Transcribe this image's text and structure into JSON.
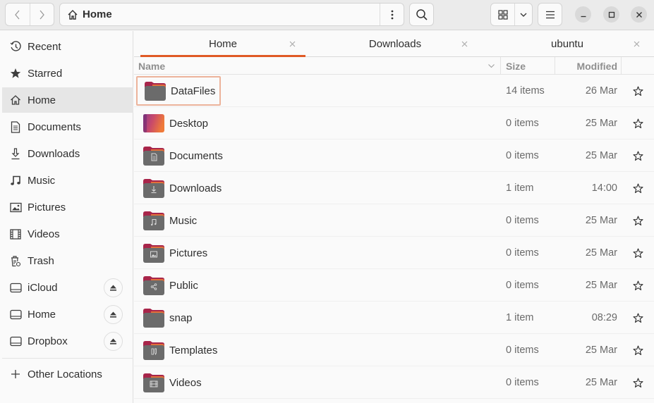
{
  "header": {
    "back_icon": "chevron-left-icon",
    "forward_icon": "chevron-right-icon",
    "path_icon": "home-icon",
    "path_label": "Home",
    "path_menu_icon": "vertical-dots-icon",
    "search_icon": "search-icon",
    "view_icon": "grid-view-icon",
    "view_dropdown_icon": "chevron-down-icon",
    "menu_icon": "hamburger-icon",
    "minimize_icon": "minimize-icon",
    "maximize_icon": "maximize-icon",
    "close_icon": "close-icon"
  },
  "sidebar": {
    "items": [
      {
        "label": "Recent",
        "icon": "clock-icon"
      },
      {
        "label": "Starred",
        "icon": "star-icon"
      },
      {
        "label": "Home",
        "icon": "home-icon",
        "active": true
      },
      {
        "label": "Documents",
        "icon": "document-icon"
      },
      {
        "label": "Downloads",
        "icon": "download-icon"
      },
      {
        "label": "Music",
        "icon": "music-icon"
      },
      {
        "label": "Pictures",
        "icon": "picture-icon"
      },
      {
        "label": "Videos",
        "icon": "video-icon"
      },
      {
        "label": "Trash",
        "icon": "trash-icon"
      },
      {
        "label": "iCloud",
        "icon": "drive-icon",
        "eject": true
      },
      {
        "label": "Home",
        "icon": "drive-icon",
        "eject": true
      },
      {
        "label": "Dropbox",
        "icon": "drive-icon",
        "eject": true
      }
    ],
    "other_locations": {
      "label": "Other Locations",
      "icon": "plus-icon"
    }
  },
  "tabs": [
    {
      "label": "Home",
      "active": true
    },
    {
      "label": "Downloads",
      "active": false
    },
    {
      "label": "ubuntu",
      "active": false
    }
  ],
  "columns": {
    "name": "Name",
    "size": "Size",
    "modified": "Modified"
  },
  "accent_color": "#e05a25",
  "files": [
    {
      "name": "DataFiles",
      "size": "14 items",
      "modified": "26 Mar",
      "emblem": "none",
      "selected": true
    },
    {
      "name": "Desktop",
      "size": "0 items",
      "modified": "25 Mar",
      "emblem": "desktop"
    },
    {
      "name": "Documents",
      "size": "0 items",
      "modified": "25 Mar",
      "emblem": "document"
    },
    {
      "name": "Downloads",
      "size": "1 item",
      "modified": "14:00",
      "emblem": "download"
    },
    {
      "name": "Music",
      "size": "0 items",
      "modified": "25 Mar",
      "emblem": "music"
    },
    {
      "name": "Pictures",
      "size": "0 items",
      "modified": "25 Mar",
      "emblem": "picture"
    },
    {
      "name": "Public",
      "size": "0 items",
      "modified": "25 Mar",
      "emblem": "share"
    },
    {
      "name": "snap",
      "size": "1 item",
      "modified": "08:29",
      "emblem": "none"
    },
    {
      "name": "Templates",
      "size": "0 items",
      "modified": "25 Mar",
      "emblem": "template"
    },
    {
      "name": "Videos",
      "size": "0 items",
      "modified": "25 Mar",
      "emblem": "video"
    }
  ]
}
